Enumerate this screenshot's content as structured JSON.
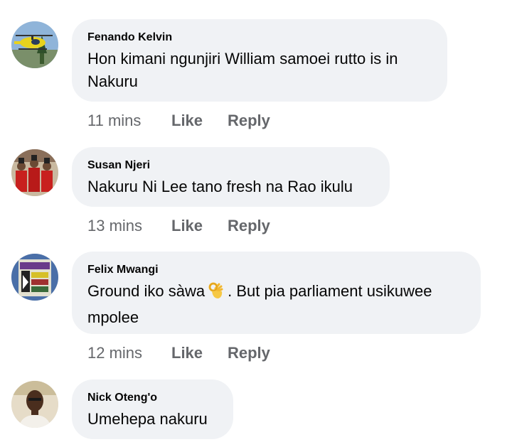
{
  "comments": [
    {
      "author": "Fenando Kelvin",
      "text": "Hon kimani ngunjiri William samoei rutto is in Nakuru",
      "time": "11 mins",
      "like": "Like",
      "reply": "Reply",
      "avatar_icon": "helicopter-photo"
    },
    {
      "author": "Susan Njeri",
      "text": "Nakuru Ni Lee tano fresh na Rao ikulu",
      "time": "13 mins",
      "like": "Like",
      "reply": "Reply",
      "avatar_icon": "group-red-uniforms-photo"
    },
    {
      "author": "Felix Mwangi",
      "text_before": "Ground iko sàwa",
      "emoji": "ok-hand-emoji",
      "text_after": ". But pia parliament usikuwee mpolee",
      "time": "12 mins",
      "like": "Like",
      "reply": "Reply",
      "avatar_icon": "poster-photo"
    },
    {
      "author": "Nick Oteng'o",
      "text": "Umehepa nakuru",
      "avatar_icon": "man-portrait-photo"
    }
  ],
  "colors": {
    "bubble": "#f0f2f5",
    "text": "#050505",
    "meta": "#65676b"
  }
}
